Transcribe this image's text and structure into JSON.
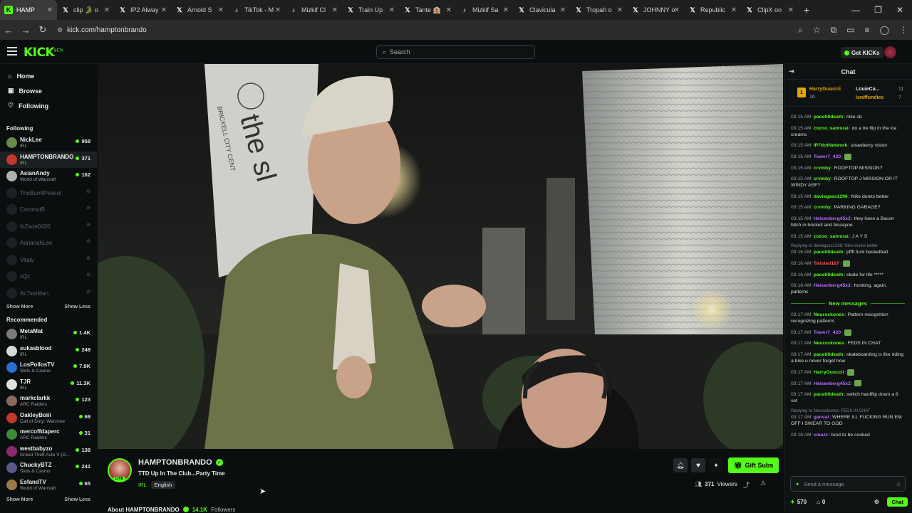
{
  "browser": {
    "tabs": [
      {
        "label": "HAMP",
        "icon": "kick-icon",
        "active": true
      },
      {
        "label": "clip 🐊 o",
        "icon": "x-icon"
      },
      {
        "label": "IP2 Alway",
        "icon": "x-icon"
      },
      {
        "label": "Arnold S",
        "icon": "x-icon"
      },
      {
        "label": "TikTok - M",
        "icon": "tiktok-icon"
      },
      {
        "label": "Mizkif Cl",
        "icon": "tiktok-icon"
      },
      {
        "label": "Train Up",
        "icon": "x-icon"
      },
      {
        "label": "Tante 🏨",
        "icon": "x-icon"
      },
      {
        "label": "Mizkif Sa",
        "icon": "tiktok-icon"
      },
      {
        "label": "Clavicula",
        "icon": "x-icon"
      },
      {
        "label": "Tropah o",
        "icon": "x-icon"
      },
      {
        "label": "JOHNNY o",
        "icon": "x-icon"
      },
      {
        "label": "Republic",
        "icon": "x-icon"
      },
      {
        "label": "ClipX on",
        "icon": "x-icon"
      }
    ],
    "url": "kick.com/hamptonbrando"
  },
  "header": {
    "logo": "KICK",
    "logo_badge": "BETA",
    "search_placeholder": "Search",
    "get_kicks": "Get KICKs"
  },
  "sidebar": {
    "nav": [
      {
        "label": "Home",
        "icon": "home-icon"
      },
      {
        "label": "Browse",
        "icon": "browse-icon"
      },
      {
        "label": "Following",
        "icon": "heart-icon"
      }
    ],
    "following_title": "Following",
    "following": [
      {
        "name": "NickLee",
        "category": "IRL",
        "viewers": "958",
        "live": true,
        "color": "#6a8a4a"
      },
      {
        "name": "HAMPTONBRANDO",
        "category": "IRL",
        "viewers": "371",
        "live": true,
        "color": "#c0392b"
      },
      {
        "name": "AsianAndy",
        "category": "World of Warcraft",
        "viewers": "162",
        "live": true,
        "color": "#b0b0b0"
      },
      {
        "name": "TheBurntPeanut",
        "live": false
      },
      {
        "name": "CoconutB",
        "live": false
      },
      {
        "name": "InZane0420",
        "live": false
      },
      {
        "name": "AdrianahLee",
        "live": false
      },
      {
        "name": "Vitaly",
        "live": false
      },
      {
        "name": "xQc",
        "live": false
      },
      {
        "name": "Ac7ionMan",
        "live": false
      }
    ],
    "show_more": "Show More",
    "show_less": "Show Less",
    "recommended_title": "Recommended",
    "recommended": [
      {
        "name": "MetaMat",
        "category": "IRL",
        "viewers": "1.4K",
        "color": "#7a7a7a"
      },
      {
        "name": "sukasblood",
        "category": "IRL",
        "viewers": "249",
        "color": "#d8d8d8"
      },
      {
        "name": "LosPollosTV",
        "category": "Slots & Casino",
        "viewers": "7.9K",
        "color": "#2a6fd0"
      },
      {
        "name": "TJR",
        "category": "IRL",
        "viewers": "11.3K",
        "color": "#e0e0e0"
      },
      {
        "name": "markclarkk",
        "category": "ARC Raiders",
        "viewers": "123",
        "color": "#8a6a5a"
      },
      {
        "name": "OakleyBoiii",
        "category": "Call of Duty: Warzone",
        "viewers": "69",
        "color": "#c0392b"
      },
      {
        "name": "mercoffdaperc",
        "category": "ARC Raiders",
        "viewers": "31",
        "color": "#3a8a3a"
      },
      {
        "name": "westbabyzo",
        "category": "Grand Theft Auto V (G...",
        "viewers": "138",
        "color": "#8a2a6a"
      },
      {
        "name": "ChuckyBTZ",
        "category": "Slots & Casino",
        "viewers": "241",
        "color": "#5a5a8a"
      },
      {
        "name": "EsfandTV",
        "category": "World of Warcraft",
        "viewers": "65",
        "color": "#9a7a4a"
      }
    ]
  },
  "stream": {
    "channel": "HAMPTONBRANDO",
    "title": "TTD Up In The Club...Party Time",
    "category": "IRL",
    "language": "English",
    "live_badge": "LIVE",
    "viewers": "371",
    "viewers_label": "Viewers",
    "gift_subs": "Gift Subs",
    "about_prefix": "About HAMPTONBRANDO",
    "followers": "14.1K",
    "followers_label": "Followers",
    "video_sign_text": "the sl",
    "video_sign_sub": "BRICKELL CITY CENT"
  },
  "chat": {
    "title": "Chat",
    "pinned": [
      {
        "rank": "1",
        "name": "HarryGuuccii",
        "count": "16"
      },
      {
        "name": "LouieCa...",
        "count": "11"
      },
      {
        "name": "Isniffundies",
        "count": "7"
      }
    ],
    "messages": [
      {
        "time": "03:15 AM",
        "user": "pacetilldeath",
        "color": "#53fc18",
        "text": "nike sb"
      },
      {
        "time": "03:15 AM",
        "user": "zozoo_samurai",
        "color": "#53fc18",
        "text": "do a tre flip in the ice creams"
      },
      {
        "time": "03:15 AM",
        "user": "IP7dotNetwork",
        "color": "#53fc18",
        "text": "strawberry vision"
      },
      {
        "time": "03:15 AM",
        "user": "Tower7_420",
        "color": "#b46cff",
        "text": ""
      },
      {
        "time": "03:15 AM",
        "user": "crvmby",
        "color": "#53fc18",
        "text": "ROOFTOP MISSION?"
      },
      {
        "time": "03:15 AM",
        "user": "crvmby",
        "color": "#53fc18",
        "text": "ROOFTOP J MISSION OR IT WINDY ASF?"
      },
      {
        "time": "03:15 AM",
        "user": "daviegass1296",
        "color": "#53fc18",
        "text": "Nike dunks better"
      },
      {
        "time": "03:15 AM",
        "user": "crvmby",
        "color": "#53fc18",
        "text": "PARKING GARAGE?"
      },
      {
        "time": "03:15 AM",
        "user": "Heisenberg45x2",
        "color": "#b46cff",
        "text": "they have a Bacon bitch in brickell and biscayne."
      },
      {
        "time": "03:15 AM",
        "user": "zozoo_samurai",
        "color": "#53fc18",
        "text": "J A Y S"
      },
      {
        "reply": "Replying to daviegass1296: Nike dunks better",
        "time": "03:16 AM",
        "user": "pacetilldeath",
        "color": "#53fc18",
        "text": "pffft fuck basketball"
      },
      {
        "time": "03:16 AM",
        "user": "Twisted187",
        "color": "#ff4d4d",
        "text": ""
      },
      {
        "time": "03:16 AM",
        "user": "pacetilldeath",
        "color": "#53fc18",
        "text": "skate for life *****"
      },
      {
        "time": "03:16 AM",
        "user": "Heisenberg45x2",
        "color": "#b46cff",
        "text": "honking. again. patterns"
      }
    ],
    "new_messages": "New messages",
    "messages2": [
      {
        "time": "03:17 AM",
        "user": "Neurockones",
        "color": "#53fc18",
        "text": "Pattern recognition recognizing patterns"
      },
      {
        "time": "03:17 AM",
        "user": "Tower7_420",
        "color": "#b46cff",
        "text": ""
      },
      {
        "time": "03:17 AM",
        "user": "Neurockones",
        "color": "#53fc18",
        "text": "FEDS IN CHAT"
      },
      {
        "time": "03:17 AM",
        "user": "pacetilldeath",
        "color": "#53fc18",
        "text": "skateboarding is like riding a bike u never forget how"
      },
      {
        "time": "03:17 AM",
        "user": "HarryGuuccii",
        "color": "#53fc18",
        "text": ""
      },
      {
        "time": "03:17 AM",
        "user": "Heisenberg45x2",
        "color": "#b46cff",
        "text": ""
      },
      {
        "time": "03:17 AM",
        "user": "pacetilldeath",
        "color": "#53fc18",
        "text": "switch hardflip down a 6 set"
      },
      {
        "reply": "Replying to Neurockones: FEDS IN CHAT",
        "time": "03:17 AM",
        "user": "ganval",
        "color": "#b46cff",
        "text": "WHERE ILL FUCKING RUN EM OFF I SWEAR TO GOD"
      },
      {
        "time": "03:18 AM",
        "user": "cmazz",
        "color": "#b46cff",
        "text": "bout to be cooked"
      }
    ],
    "input_placeholder": "Send a message",
    "kicks_count": "570",
    "other_count": "0",
    "send_label": "Chat"
  }
}
